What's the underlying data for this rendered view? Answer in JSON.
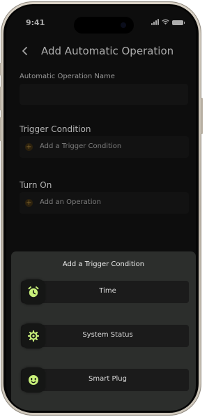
{
  "status_bar": {
    "time": "9:41"
  },
  "header": {
    "title": "Add Automatic Operation"
  },
  "form": {
    "name_label": "Automatic Operation Name",
    "name_value": "",
    "trigger_section_title": "Trigger Condition",
    "trigger_add_label": "Add a Trigger Condition",
    "operation_section_title": "Turn On",
    "operation_add_label": "Add an Operation"
  },
  "sheet": {
    "title": "Add a Trigger Condition",
    "options": [
      {
        "label": "Time",
        "icon": "alarm-clock-icon"
      },
      {
        "label": "System Status",
        "icon": "gear-sync-icon"
      },
      {
        "label": "Smart Plug",
        "icon": "plug-socket-icon"
      }
    ]
  },
  "colors": {
    "accent_green": "#c8f07a",
    "accent_gold": "#b08a3f",
    "background": "#121212",
    "sheet_background": "#2c2e2c"
  }
}
